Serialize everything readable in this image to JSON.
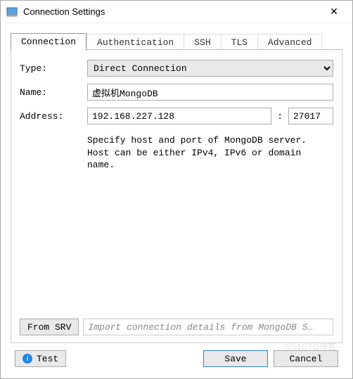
{
  "window": {
    "title": "Connection Settings",
    "close_glyph": "✕"
  },
  "tabs": [
    {
      "label": "Connection"
    },
    {
      "label": "Authentication"
    },
    {
      "label": "SSH"
    },
    {
      "label": "TLS"
    },
    {
      "label": "Advanced"
    }
  ],
  "form": {
    "type_label": "Type:",
    "type_value": "Direct Connection",
    "name_label": "Name:",
    "name_value": "虚拟机MongoDB",
    "address_label": "Address:",
    "address_host": "192.168.227.128",
    "address_sep": ":",
    "address_port": "27017",
    "hint": "Specify host and port of MongoDB server. Host can be either IPv4, IPv6 or domain name."
  },
  "srv": {
    "button_label": "From SRV",
    "placeholder": "Import connection details from MongoDB S…"
  },
  "buttons": {
    "test": "Test",
    "save": "Save",
    "cancel": "Cancel"
  },
  "watermark": "@51CTO博客"
}
